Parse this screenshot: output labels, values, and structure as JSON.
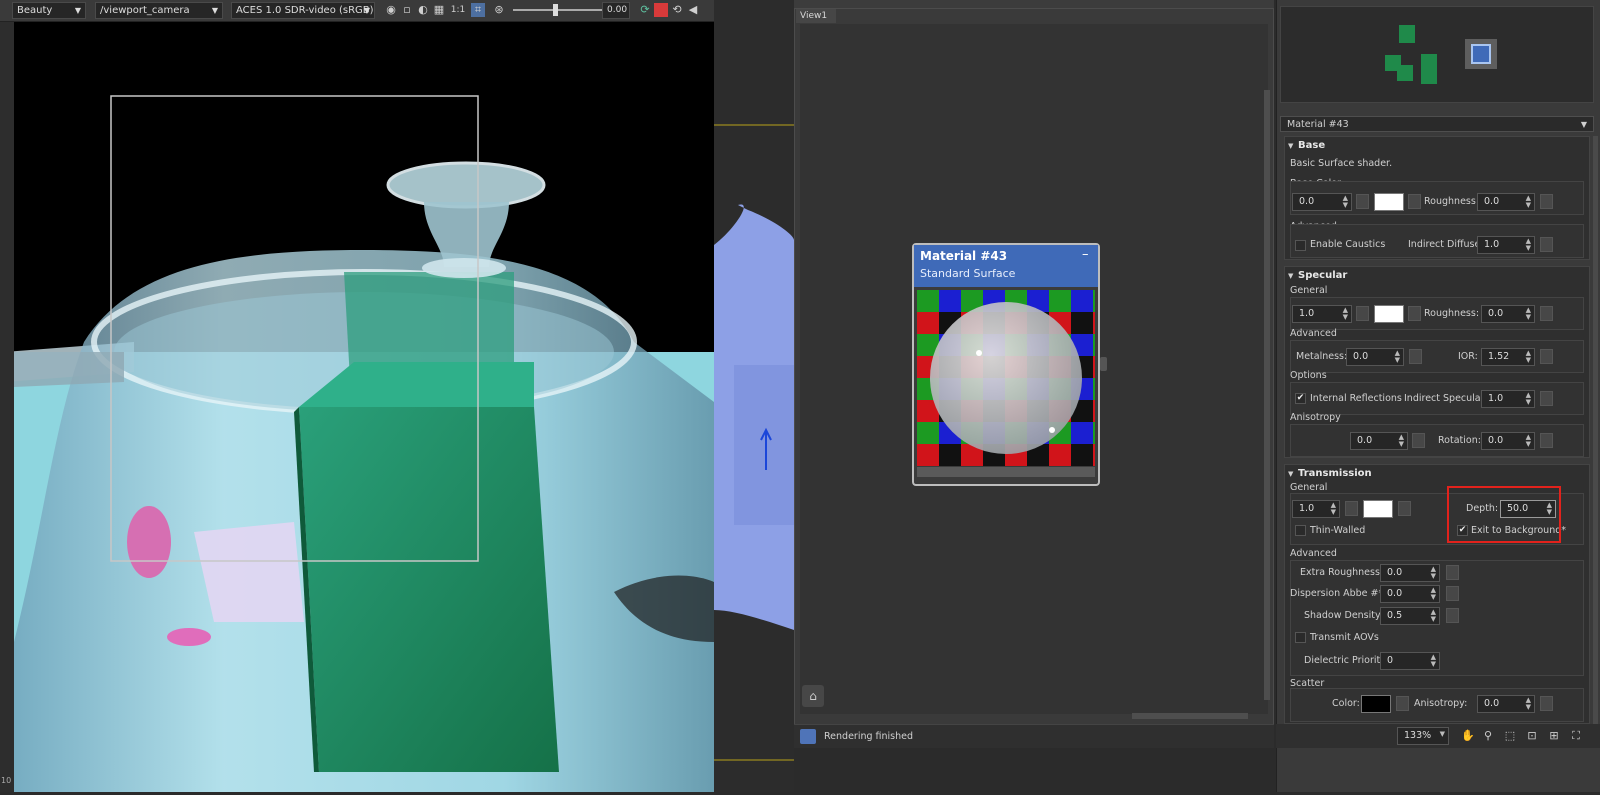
{
  "render_toolbar": {
    "channel": "Beauty",
    "camera": "/viewport_camera",
    "color_space": "ACES 1.0 SDR-video (sRGB)",
    "zoom_ratio": "1:1",
    "exposure_value": "0.00"
  },
  "left_strip_text": "10",
  "view": {
    "tab": "View1",
    "status": "Rendering finished",
    "zoom": "133%"
  },
  "node": {
    "title": "Material #43",
    "subtitle": "Standard Surface",
    "collapse": "–"
  },
  "material_dropdown": "Material #43",
  "base": {
    "header": "Base",
    "description": "Basic Surface shader.",
    "base_color_label": "Base Color",
    "weight": "0.0",
    "roughness_label": "Roughness:",
    "roughness": "0.0",
    "advanced_label": "Advanced",
    "enable_caustics": "Enable Caustics",
    "indirect_diffuse_label": "Indirect Diffuse:",
    "indirect_diffuse": "1.0"
  },
  "specular": {
    "header": "Specular",
    "general_label": "General",
    "weight": "1.0",
    "roughness_label": "Roughness:",
    "roughness": "0.0",
    "advanced_label": "Advanced",
    "metalness_label": "Metalness:",
    "metalness": "0.0",
    "ior_label": "IOR:",
    "ior": "1.52",
    "options_label": "Options",
    "internal_reflections": "Internal Reflections",
    "indirect_specular_label": "Indirect Specular:",
    "indirect_specular": "1.0",
    "anisotropy_label": "Anisotropy",
    "anisotropy": "0.0",
    "rotation_label": "Rotation:",
    "rotation": "0.0"
  },
  "transmission": {
    "header": "Transmission",
    "general_label": "General",
    "weight": "1.0",
    "depth_label": "Depth:",
    "depth": "50.0",
    "thin_walled": "Thin-Walled",
    "exit_to_background": "Exit to Background*",
    "advanced_label": "Advanced",
    "extra_roughness_label": "Extra Roughness:",
    "extra_roughness": "0.0",
    "dispersion_label": "Dispersion Abbe #*:",
    "dispersion": "0.0",
    "shadow_density_label": "Shadow Density:",
    "shadow_density": "0.5",
    "transmit_aovs": "Transmit AOVs",
    "dielectric_priority_label": "Dielectric Priority",
    "dielectric_priority": "0",
    "scatter_label": "Scatter",
    "color_label": "Color:",
    "anisotropy_label": "Anisotropy:",
    "anisotropy": "0.0"
  },
  "colors": {
    "selection_red": "#e2221c",
    "node_header": "#3f6ab8",
    "teapot_bg": "#8ed6df",
    "cube_green": "#1e8a5e"
  }
}
